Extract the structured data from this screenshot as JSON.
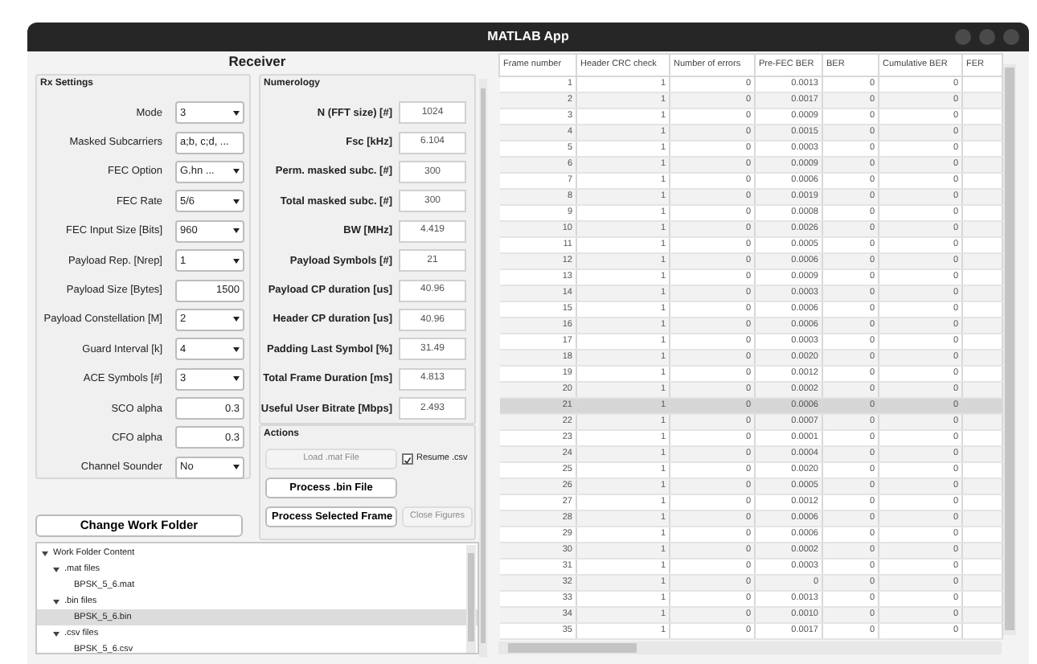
{
  "window": {
    "title": "MATLAB App"
  },
  "panel_title": "Receiver",
  "rx_settings": {
    "title": "Rx Settings",
    "fields": [
      {
        "label": "Mode",
        "kind": "select",
        "value": "3"
      },
      {
        "label": "Masked Subcarriers",
        "kind": "text",
        "value": "a;b, c;d, ..."
      },
      {
        "label": "FEC Option",
        "kind": "select",
        "value": "G.hn ..."
      },
      {
        "label": "FEC Rate",
        "kind": "select",
        "value": "5/6"
      },
      {
        "label": "FEC Input Size [Bits]",
        "kind": "select",
        "value": "960"
      },
      {
        "label": "Payload Rep. [Nrep]",
        "kind": "select",
        "value": "1"
      },
      {
        "label": "Payload Size [Bytes]",
        "kind": "number",
        "value": "1500"
      },
      {
        "label": "Payload Constellation [M]",
        "kind": "select",
        "value": "2"
      },
      {
        "label": "Guard Interval [k]",
        "kind": "select",
        "value": "4"
      },
      {
        "label": "ACE Symbols [#]",
        "kind": "select",
        "value": "3"
      },
      {
        "label": "SCO alpha",
        "kind": "number",
        "value": "0.3"
      },
      {
        "label": "CFO alpha",
        "kind": "number",
        "value": "0.3"
      },
      {
        "label": "Channel Sounder",
        "kind": "select",
        "value": "No"
      }
    ]
  },
  "numerology": {
    "title": "Numerology",
    "fields": [
      {
        "label": "N (FFT size) [#]",
        "value": "1024"
      },
      {
        "label": "Fsc [kHz]",
        "value": "6.104"
      },
      {
        "label": "Perm. masked subc. [#]",
        "value": "300"
      },
      {
        "label": "Total masked subc. [#]",
        "value": "300"
      },
      {
        "label": "BW [MHz]",
        "value": "4.419"
      },
      {
        "label": "Payload Symbols [#]",
        "value": "21"
      },
      {
        "label": "Payload CP duration [us]",
        "value": "40.96"
      },
      {
        "label": "Header CP duration [us]",
        "value": "40.96"
      },
      {
        "label": "Padding Last Symbol [%]",
        "value": "31.49"
      },
      {
        "label": "Total Frame Duration [ms]",
        "value": "4.813"
      },
      {
        "label": "Useful User Bitrate [Mbps]",
        "value": "2.493"
      }
    ]
  },
  "actions": {
    "title": "Actions",
    "items": [
      {
        "kind": "button",
        "label": "Load .mat File",
        "disabled": true
      },
      {
        "kind": "checkbox",
        "label": "Resume .csv",
        "checked": true
      },
      {
        "kind": "button",
        "label": "Process .bin File",
        "disabled": false
      },
      {
        "kind": "spacer"
      },
      {
        "kind": "button",
        "label": "Process Selected Frame",
        "disabled": false
      },
      {
        "kind": "button",
        "label": "Close Figures",
        "disabled": true
      }
    ]
  },
  "change_folder_button": "Change Work Folder",
  "tree": [
    {
      "label": "Work Folder Content",
      "expanded": true,
      "selected": false,
      "children": [
        {
          "label": ".mat files",
          "expanded": true,
          "selected": false,
          "children": [
            {
              "label": "BPSK_5_6.mat",
              "selected": false
            }
          ]
        },
        {
          "label": ".bin files",
          "expanded": true,
          "selected": false,
          "children": [
            {
              "label": "BPSK_5_6.bin",
              "selected": true
            }
          ]
        },
        {
          "label": ".csv files",
          "expanded": true,
          "selected": false,
          "children": [
            {
              "label": "BPSK_5_6.csv",
              "selected": false
            }
          ]
        }
      ]
    }
  ],
  "table": {
    "columns": [
      "Frame number",
      "Header CRC check",
      "Number of errors",
      "Pre-FEC BER",
      "BER",
      "Cumulative BER",
      "FER"
    ],
    "rows": [
      {
        "cells": [
          "1",
          "1",
          "0",
          "0.0013",
          "0",
          "0",
          ""
        ],
        "selected": false
      },
      {
        "cells": [
          "2",
          "1",
          "0",
          "0.0017",
          "0",
          "0",
          ""
        ],
        "selected": false
      },
      {
        "cells": [
          "3",
          "1",
          "0",
          "0.0009",
          "0",
          "0",
          ""
        ],
        "selected": false
      },
      {
        "cells": [
          "4",
          "1",
          "0",
          "0.0015",
          "0",
          "0",
          ""
        ],
        "selected": false
      },
      {
        "cells": [
          "5",
          "1",
          "0",
          "0.0003",
          "0",
          "0",
          ""
        ],
        "selected": false
      },
      {
        "cells": [
          "6",
          "1",
          "0",
          "0.0009",
          "0",
          "0",
          ""
        ],
        "selected": false
      },
      {
        "cells": [
          "7",
          "1",
          "0",
          "0.0006",
          "0",
          "0",
          ""
        ],
        "selected": false
      },
      {
        "cells": [
          "8",
          "1",
          "0",
          "0.0019",
          "0",
          "0",
          ""
        ],
        "selected": false
      },
      {
        "cells": [
          "9",
          "1",
          "0",
          "0.0008",
          "0",
          "0",
          ""
        ],
        "selected": false
      },
      {
        "cells": [
          "10",
          "1",
          "0",
          "0.0026",
          "0",
          "0",
          ""
        ],
        "selected": false
      },
      {
        "cells": [
          "11",
          "1",
          "0",
          "0.0005",
          "0",
          "0",
          ""
        ],
        "selected": false
      },
      {
        "cells": [
          "12",
          "1",
          "0",
          "0.0006",
          "0",
          "0",
          ""
        ],
        "selected": false
      },
      {
        "cells": [
          "13",
          "1",
          "0",
          "0.0009",
          "0",
          "0",
          ""
        ],
        "selected": false
      },
      {
        "cells": [
          "14",
          "1",
          "0",
          "0.0003",
          "0",
          "0",
          ""
        ],
        "selected": false
      },
      {
        "cells": [
          "15",
          "1",
          "0",
          "0.0006",
          "0",
          "0",
          ""
        ],
        "selected": false
      },
      {
        "cells": [
          "16",
          "1",
          "0",
          "0.0006",
          "0",
          "0",
          ""
        ],
        "selected": false
      },
      {
        "cells": [
          "17",
          "1",
          "0",
          "0.0003",
          "0",
          "0",
          ""
        ],
        "selected": false
      },
      {
        "cells": [
          "18",
          "1",
          "0",
          "0.0020",
          "0",
          "0",
          ""
        ],
        "selected": false
      },
      {
        "cells": [
          "19",
          "1",
          "0",
          "0.0012",
          "0",
          "0",
          ""
        ],
        "selected": false
      },
      {
        "cells": [
          "20",
          "1",
          "0",
          "0.0002",
          "0",
          "0",
          ""
        ],
        "selected": false
      },
      {
        "cells": [
          "21",
          "1",
          "0",
          "0.0006",
          "0",
          "0",
          ""
        ],
        "selected": true
      },
      {
        "cells": [
          "22",
          "1",
          "0",
          "0.0007",
          "0",
          "0",
          ""
        ],
        "selected": false
      },
      {
        "cells": [
          "23",
          "1",
          "0",
          "0.0001",
          "0",
          "0",
          ""
        ],
        "selected": false
      },
      {
        "cells": [
          "24",
          "1",
          "0",
          "0.0004",
          "0",
          "0",
          ""
        ],
        "selected": false
      },
      {
        "cells": [
          "25",
          "1",
          "0",
          "0.0020",
          "0",
          "0",
          ""
        ],
        "selected": false
      },
      {
        "cells": [
          "26",
          "1",
          "0",
          "0.0005",
          "0",
          "0",
          ""
        ],
        "selected": false
      },
      {
        "cells": [
          "27",
          "1",
          "0",
          "0.0012",
          "0",
          "0",
          ""
        ],
        "selected": false
      },
      {
        "cells": [
          "28",
          "1",
          "0",
          "0.0006",
          "0",
          "0",
          ""
        ],
        "selected": false
      },
      {
        "cells": [
          "29",
          "1",
          "0",
          "0.0006",
          "0",
          "0",
          ""
        ],
        "selected": false
      },
      {
        "cells": [
          "30",
          "1",
          "0",
          "0.0002",
          "0",
          "0",
          ""
        ],
        "selected": false
      },
      {
        "cells": [
          "31",
          "1",
          "0",
          "0.0003",
          "0",
          "0",
          ""
        ],
        "selected": false
      },
      {
        "cells": [
          "32",
          "1",
          "0",
          "0",
          "0",
          "0",
          ""
        ],
        "selected": false
      },
      {
        "cells": [
          "33",
          "1",
          "0",
          "0.0013",
          "0",
          "0",
          ""
        ],
        "selected": false
      },
      {
        "cells": [
          "34",
          "1",
          "0",
          "0.0010",
          "0",
          "0",
          ""
        ],
        "selected": false
      },
      {
        "cells": [
          "35",
          "1",
          "0",
          "0.0017",
          "0",
          "0",
          ""
        ],
        "selected": false
      }
    ]
  }
}
